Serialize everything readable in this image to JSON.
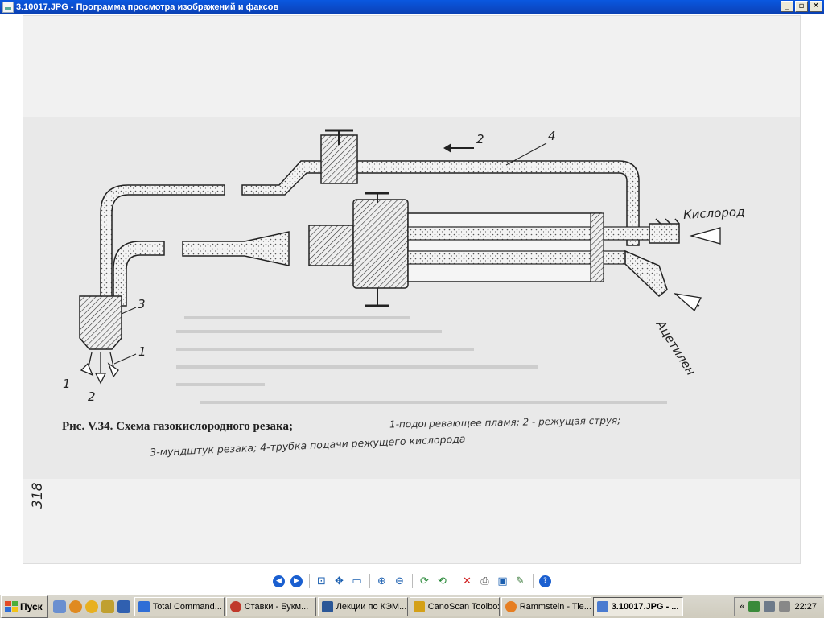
{
  "window": {
    "title": "3.10017.JPG - Программа просмотра изображений и факсов",
    "min": "_",
    "max": "▫",
    "close": "✕"
  },
  "document": {
    "caption_printed": "Рис. V.34. Схема газокислородного резака;",
    "caption_handwritten_1": "1-подогревающее пламя; 2 - режущая струя;",
    "caption_handwritten_2": "3-мундштук резака; 4-трубка подачи режущего кислорода",
    "label_oxygen": "Кислород",
    "label_acetylene": "Ацетилен",
    "label_1a": "1",
    "label_1b": "1",
    "label_2a": "2",
    "label_2b": "2",
    "label_3": "3",
    "label_4": "4",
    "page_number": "318"
  },
  "toolbar": {
    "icons": [
      "previous-icon",
      "next-icon",
      "best-fit-icon",
      "actual-size-icon",
      "slideshow-icon",
      "zoom-in-icon",
      "zoom-out-icon",
      "rotate-cw-icon",
      "rotate-ccw-icon",
      "delete-icon",
      "print-icon",
      "save-icon",
      "edit-icon",
      "help-icon"
    ]
  },
  "taskbar": {
    "start": "Пуск",
    "tasks": [
      {
        "label": "Total Command...",
        "color": "#2f6ed6"
      },
      {
        "label": "Ставки - Букм...",
        "color": "#c0392b"
      },
      {
        "label": "Лекции по КЭМ...",
        "color": "#2b5797"
      },
      {
        "label": "CanoScan Toolbox",
        "color": "#d4a017"
      },
      {
        "label": "Rammstein - Tie...",
        "color": "#e67e22"
      },
      {
        "label": "3.10017.JPG - ...",
        "color": "#4a7bd0"
      }
    ],
    "tray_expand": "«",
    "clock": "22:27"
  }
}
